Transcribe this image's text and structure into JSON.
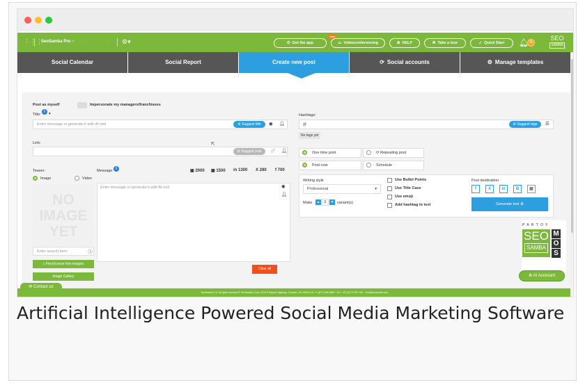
{
  "window": {
    "dots": [
      "#ff5f57",
      "#ffbd2e",
      "#28c940"
    ]
  },
  "topnav": {
    "brand": "SeoSamba Pro",
    "crumbs": "> · · · · ·",
    "buttons": [
      {
        "label": "Get the app",
        "icon": "phone-icon"
      },
      {
        "label": "Videoconferencing",
        "icon": "video-icon"
      },
      {
        "label": "HELP",
        "icon": "help-icon"
      },
      {
        "label": "Take a tour",
        "icon": "star-icon"
      },
      {
        "label": "Quick Start",
        "icon": "rocket-icon"
      }
    ],
    "new_badge": "new",
    "notification_count": "11",
    "logo_top": "SEO",
    "logo_bottom": "SAMBA"
  },
  "tabs": [
    {
      "label": "Social Calendar",
      "active": false
    },
    {
      "label": "Social Report",
      "active": false
    },
    {
      "label": "Create new post",
      "active": true
    },
    {
      "label": "Social accounts",
      "active": false,
      "icon": "refresh-icon"
    },
    {
      "label": "Manage templates",
      "active": false,
      "icon": "gear-icon"
    }
  ],
  "form": {
    "post_as_label": "Post as myself",
    "impersonate_label": "Impersonate my managers/franchisees",
    "title_label": "Title:",
    "title_placeholder": "Enter message or generate it with AI tool",
    "suggest_title": "Suggest title",
    "link_label": "Link:",
    "suggest_post": "Suggest post",
    "hashtags_label": "Hashtags:",
    "hashtag_prefix": "#",
    "suggest_tags": "Suggest tags",
    "no_tags": "No tags yet",
    "one_time_post": "One time post",
    "repeating_post": "Repeating post",
    "post_now": "Post now",
    "schedule": "Schedule",
    "teaser_label": "Teaser:",
    "image_option": "Image",
    "video_option": "Video",
    "message_label": "Message:",
    "message_placeholder": "Enter message or generate it with AI tool",
    "search_placeholder": "Enter search term",
    "find_images": "Find license free images",
    "image_gallery": "Image Gallery",
    "clear_all": "Clear all",
    "no_image_text": [
      "NO",
      "IMAGE",
      "YET"
    ],
    "char_limits": [
      {
        "icon": "facebook-icon",
        "value": "2000"
      },
      {
        "icon": "gbp-icon",
        "value": "1500"
      },
      {
        "icon": "linkedin-icon",
        "value": "in 1300"
      },
      {
        "icon": "x-icon",
        "value": "X 280"
      },
      {
        "icon": "facebook-f-icon",
        "value": "f 700"
      }
    ]
  },
  "ai_tool": {
    "writing_style_label": "Writing style",
    "writing_style_value": "Professional",
    "make_label": "Make",
    "variant_count": "3",
    "variants_label": "variant(s)",
    "options": [
      "Use Bullet Points",
      "Use Title Case",
      "Use emoji",
      "Add hashtag to text"
    ],
    "destination_label": "Post destination",
    "destinations": [
      "f",
      "X",
      "in",
      "B",
      "▦"
    ],
    "generate_label": "Generate text"
  },
  "badge": {
    "part_of": "P A R T  O F",
    "seo": "SEO",
    "samba": "SAMBA",
    "letters": [
      "M",
      "O",
      "S"
    ]
  },
  "ai_assistant": "AI Assistant",
  "contact_us": "Contact us",
  "footer_text": "SeoSamba 2.0. All rights reserved © SeoSamba Corp. 2190 S Dupont Highway, Camden, DE 19934 US. +1 (877) 960-9894 · EU: +33 (0)770 637 026 · info@seosamba.com",
  "caption": "Artificial Intelligence Powered Social Media Marketing Software"
}
